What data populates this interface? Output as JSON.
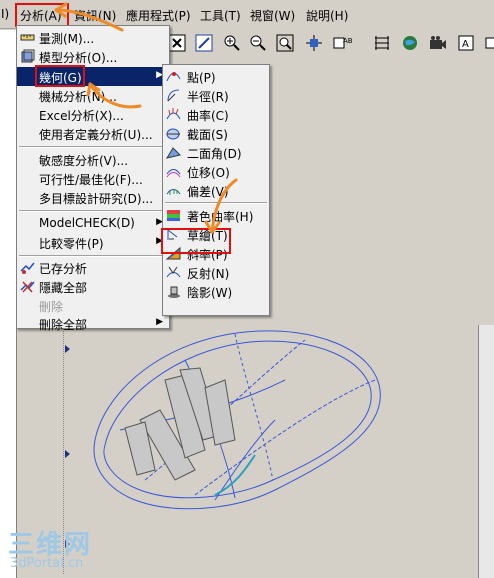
{
  "menubar": {
    "items": [
      {
        "label": "I)"
      },
      {
        "label": "分析(A)"
      },
      {
        "label": "資訊(N)"
      },
      {
        "label": "應用程式(P)"
      },
      {
        "label": "工具(T)"
      },
      {
        "label": "視窗(W)"
      },
      {
        "label": "說明(H)"
      }
    ]
  },
  "analysis_menu": {
    "items": [
      {
        "label": "量測(M)...",
        "icon": "ruler-icon"
      },
      {
        "label": "模型分析(O)...",
        "icon": "model-analysis-icon"
      },
      {
        "label": "幾何(G)",
        "submenu": true
      },
      {
        "label": "機械分析(N)..."
      },
      {
        "label": "Excel分析(X)..."
      },
      {
        "label": "使用者定義分析(U)..."
      },
      {
        "label": "敏感度分析(V)..."
      },
      {
        "label": "可行性/最佳化(F)..."
      },
      {
        "label": "多目標設計研究(D)..."
      },
      {
        "label": "ModelCHECK(D)",
        "submenu": true
      },
      {
        "label": "比較零件(P)",
        "submenu": true
      },
      {
        "label": "已存分析",
        "icon": "saved-analysis-icon"
      },
      {
        "label": "隱藏全部",
        "icon": "hide-all-icon"
      },
      {
        "label": "刪除",
        "disabled": true
      },
      {
        "label": "刪除全部",
        "submenu": true
      }
    ]
  },
  "geometry_submenu": {
    "items": [
      {
        "label": "點(P)",
        "icon": "point-icon"
      },
      {
        "label": "半徑(R)",
        "icon": "radius-icon"
      },
      {
        "label": "曲率(C)",
        "icon": "curvature-icon"
      },
      {
        "label": "截面(S)",
        "icon": "section-icon"
      },
      {
        "label": "二面角(D)",
        "icon": "dihedral-icon"
      },
      {
        "label": "位移(O)",
        "icon": "offset-icon"
      },
      {
        "label": "偏差(V)",
        "icon": "deviation-icon"
      },
      {
        "label": "著色曲率(H)",
        "icon": "shaded-curvature-icon"
      },
      {
        "label": "草繪(T)",
        "icon": "sketch-icon"
      },
      {
        "label": "斜率(P)",
        "icon": "slope-icon"
      },
      {
        "label": "反射(N)",
        "icon": "reflection-icon"
      },
      {
        "label": "陰影(W)",
        "icon": "shadow-icon"
      }
    ]
  },
  "watermark": {
    "logo": "三维网",
    "url": "3dPortal.cn"
  },
  "colors": {
    "highlight": "#0a246a",
    "annotation_box": "#e01010",
    "annotation_arrow": "#f08a24",
    "model_wire": "#3a57d6",
    "watermark": "#9fc7e6"
  }
}
